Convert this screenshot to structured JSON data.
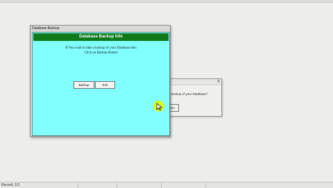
{
  "message_box": {
    "close_glyph": "X",
    "text": "a backup of your Database?",
    "button_label": "No"
  },
  "dialog": {
    "title": "Database Backup",
    "banner": "Database Backup Info",
    "info_line1": "If You want to take a backup of your Database then",
    "info_line2": "Click on Backup Button",
    "backup_label": "Backup",
    "exit_label": "Exit"
  },
  "statusbar": {
    "text": "Record: 1/3"
  },
  "icons": {
    "cursor": "mouse-pointer-icon",
    "close": "close-icon"
  }
}
